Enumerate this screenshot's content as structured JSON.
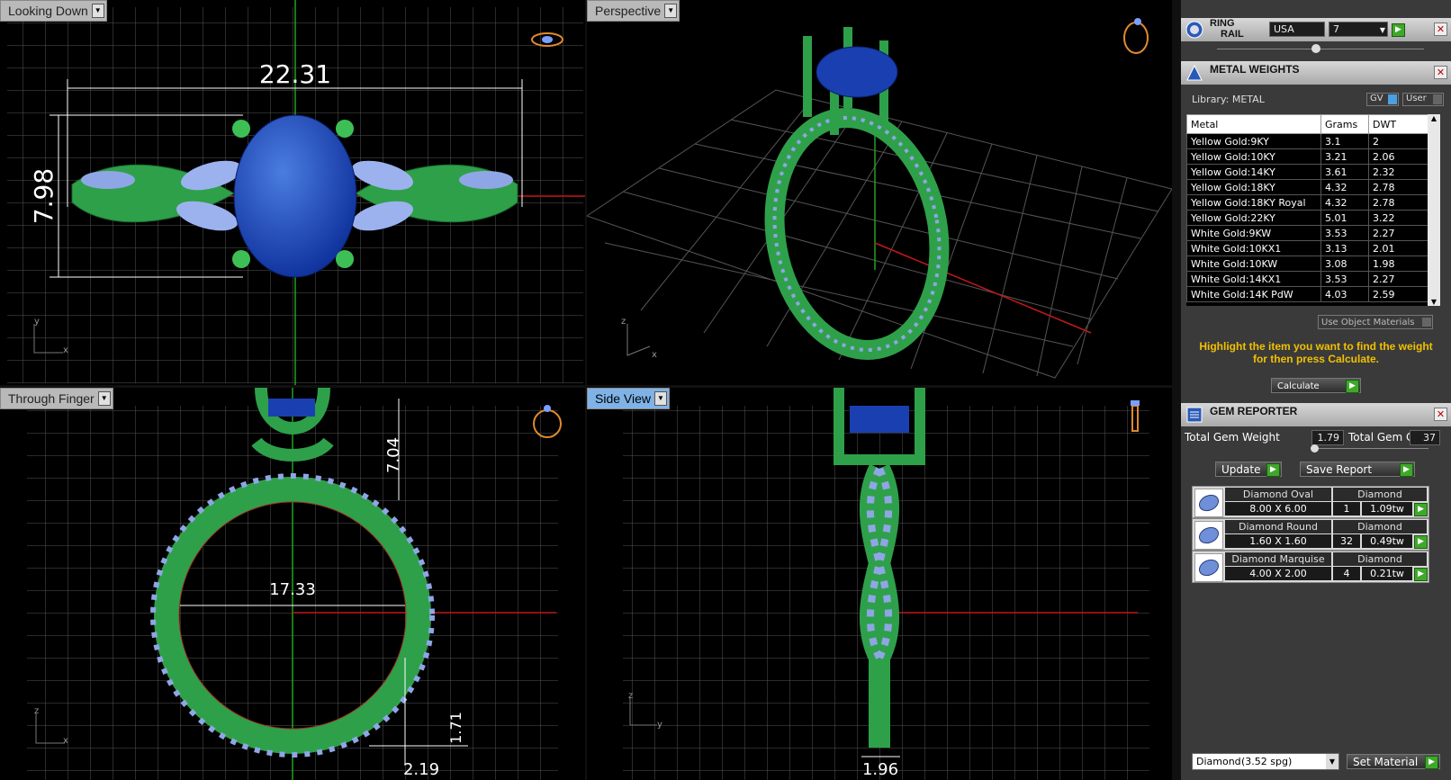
{
  "viewports": {
    "top_left": {
      "label": "Looking Down",
      "dim_width": "22.31",
      "dim_height": "7.98"
    },
    "top_right": {
      "label": "Perspective"
    },
    "bottom_left": {
      "label": "Through Finger",
      "dim_diameter": "17.33",
      "dim_top": "7.04",
      "dim_bottom": "2.19",
      "dim_small": "1.71"
    },
    "bottom_right": {
      "label": "Side View",
      "dim_width": "1.96"
    }
  },
  "axes": {
    "x": "x",
    "y": "y",
    "z": "z"
  },
  "ring_rail": {
    "title_line1": "RING",
    "title_line2": "RAIL",
    "country": "USA",
    "size": "7"
  },
  "metal_weights": {
    "title": "METAL WEIGHTS",
    "library_label": "Library: METAL",
    "gv_label": "GV",
    "user_label": "User",
    "columns": [
      "Metal",
      "Grams",
      "DWT"
    ],
    "rows": [
      [
        "Yellow Gold:9KY",
        "3.1",
        "2"
      ],
      [
        "Yellow Gold:10KY",
        "3.21",
        "2.06"
      ],
      [
        "Yellow Gold:14KY",
        "3.61",
        "2.32"
      ],
      [
        "Yellow Gold:18KY",
        "4.32",
        "2.78"
      ],
      [
        "Yellow Gold:18KY Royal",
        "4.32",
        "2.78"
      ],
      [
        "Yellow Gold:22KY",
        "5.01",
        "3.22"
      ],
      [
        "White Gold:9KW",
        "3.53",
        "2.27"
      ],
      [
        "White Gold:10KX1",
        "3.13",
        "2.01"
      ],
      [
        "White Gold:10KW",
        "3.08",
        "1.98"
      ],
      [
        "White Gold:14KX1",
        "3.53",
        "2.27"
      ],
      [
        "White Gold:14K PdW",
        "4.03",
        "2.59"
      ]
    ],
    "use_object_materials": "Use Object Materials",
    "hint": "Highlight the item you want to find the weight for then press Calculate.",
    "calculate_label": "Calculate"
  },
  "gem_reporter": {
    "title": "GEM REPORTER",
    "total_weight_label": "Total Gem Weight",
    "total_weight_value": "1.79",
    "total_count_label": "Total Gem Count",
    "total_count_value": "37",
    "update_label": "Update",
    "save_report_label": "Save Report",
    "gems": [
      {
        "name": "Diamond Oval",
        "material": "Diamond",
        "size": "8.00 X 6.00",
        "count": "1",
        "weight": "1.09tw"
      },
      {
        "name": "Diamond Round",
        "material": "Diamond",
        "size": "1.60 X 1.60",
        "count": "32",
        "weight": "0.49tw"
      },
      {
        "name": "Diamond Marquise",
        "material": "Diamond",
        "size": "4.00 X 2.00",
        "count": "4",
        "weight": "0.21tw"
      }
    ],
    "material_select": "Diamond",
    "material_spg": "(3.52 spg)",
    "set_material_label": "Set Material"
  }
}
